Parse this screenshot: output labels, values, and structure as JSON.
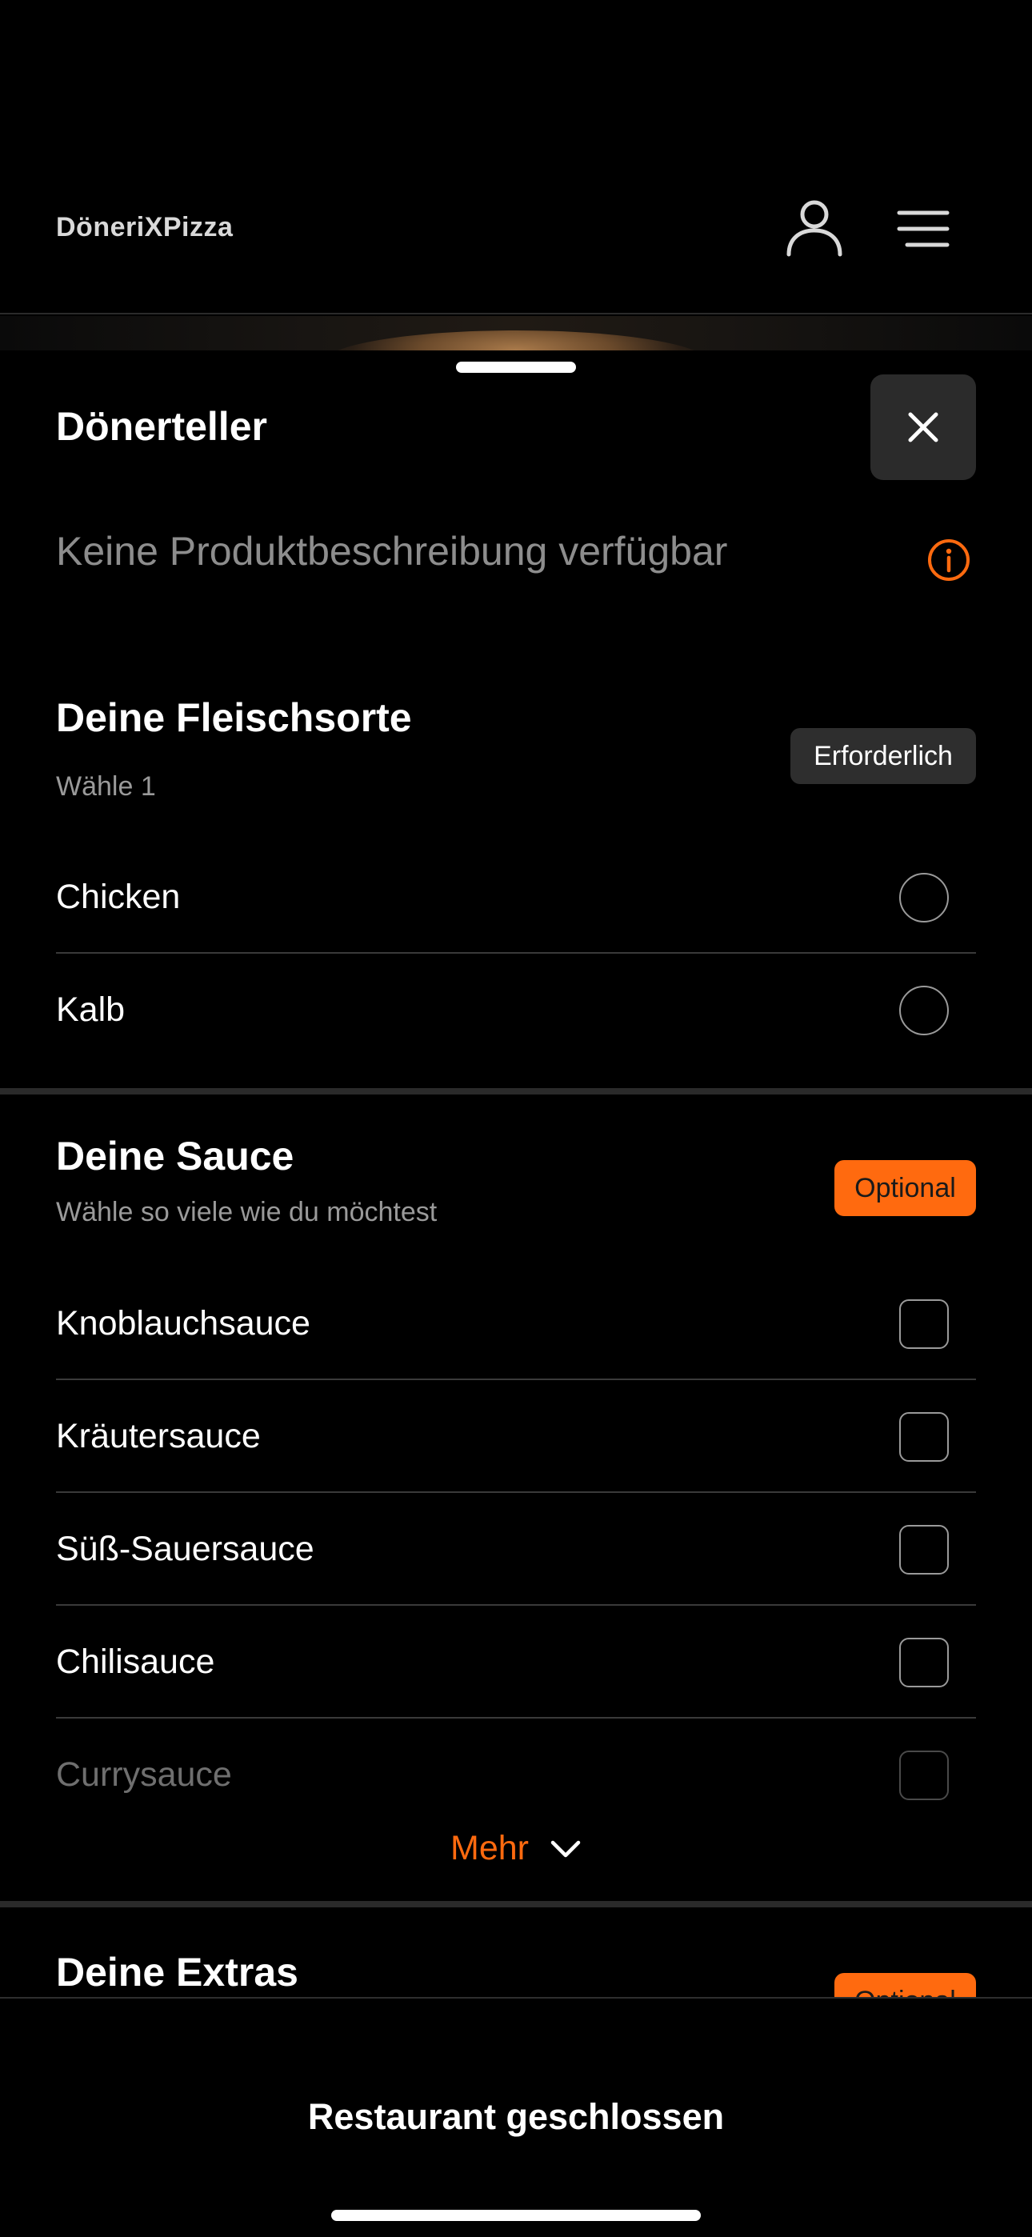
{
  "header": {
    "brand": "DöneriXPizza",
    "user_icon": "user-icon",
    "menu_icon": "menu-icon"
  },
  "product": {
    "title": "Dönerteller",
    "description": "Keine Produktbeschreibung verfügbar"
  },
  "groups": [
    {
      "title": "Deine Fleischsorte",
      "subtitle": "Wähle 1",
      "badge": "Erforderlich",
      "type": "radio",
      "options": [
        "Chicken",
        "Kalb"
      ]
    },
    {
      "title": "Deine Sauce",
      "subtitle": "Wähle so viele wie du möchtest",
      "badge": "Optional",
      "type": "checkbox",
      "options": [
        "Knoblauchsauce",
        "Kräutersauce",
        "Süß-Sauersauce",
        "Chilisauce",
        "Currysauce"
      ],
      "more_label": "Mehr"
    },
    {
      "title": "Deine Extras",
      "badge": "Optional"
    }
  ],
  "footer": {
    "status": "Restaurant geschlossen"
  },
  "colors": {
    "accent": "#ff6a0f",
    "background": "#000000",
    "badge_dark": "#2e2e2e"
  }
}
